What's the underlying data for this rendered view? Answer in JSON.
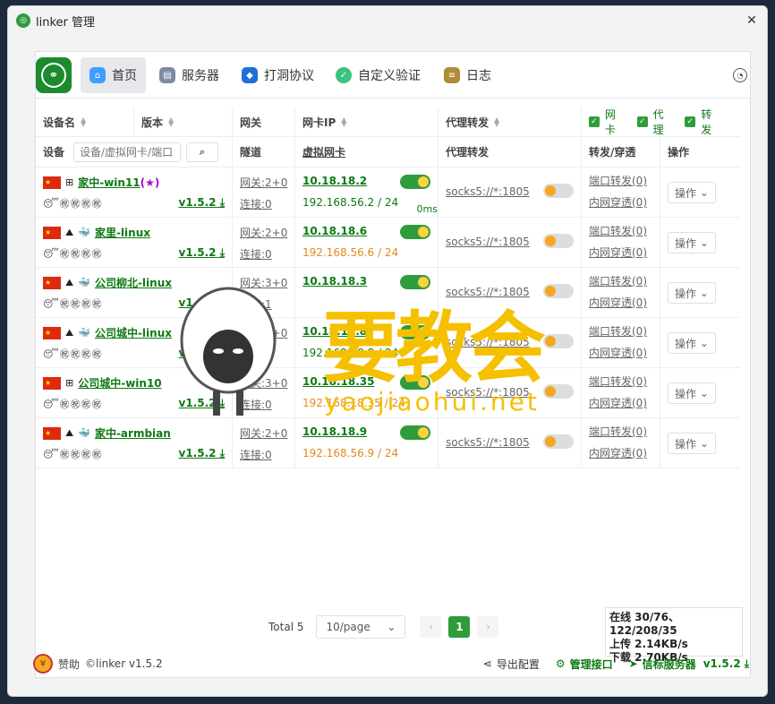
{
  "window": {
    "title": "linker 管理",
    "close_symbol": "✕"
  },
  "nav": {
    "items": [
      {
        "label": "首页",
        "icon": "home-icon",
        "active": true
      },
      {
        "label": "服务器",
        "icon": "server-icon"
      },
      {
        "label": "打洞协议",
        "icon": "protocol-icon"
      },
      {
        "label": "自定义验证",
        "icon": "shield-icon"
      },
      {
        "label": "日志",
        "icon": "log-icon"
      }
    ]
  },
  "header": {
    "device": "设备名",
    "version": "版本",
    "gateway": "网关",
    "nic_ip": "网卡IP",
    "proxy": "代理转发",
    "check_nic": "网卡",
    "check_proxy": "代理",
    "check_forward": "转发",
    "device2": "设备",
    "search_placeholder": "设备/虚拟网卡/端口",
    "tunnel": "隧道",
    "virtual_nic": "虚拟网卡",
    "proxy2": "代理转发",
    "forward_pen": "转发/穿透",
    "ops": "操作"
  },
  "rows": [
    {
      "name": "家中-win11",
      "star": "(★)",
      "os": "win",
      "emojis": "😴㊗㊗㊗㊗",
      "version": "v1.5.2",
      "gateway": "网关:2+0",
      "conn": "连接:0",
      "ip": "10.18.18.2",
      "lan": "192.168.56.2 / 24",
      "lan_orange": false,
      "ms": "0ms",
      "proxy": "socks5://*:1805",
      "port_fwd": "端口转发(0)",
      "lan_pen": "内网穿透(0)",
      "op": "操作"
    },
    {
      "name": "家里-linux",
      "star": "",
      "os": "linux",
      "emojis": "😴㊗㊗㊗㊗",
      "version": "v1.5.2",
      "gateway": "网关:2+0",
      "conn": "连接:0",
      "ip": "10.18.18.6",
      "lan": "192.168.56.6 / 24",
      "lan_orange": true,
      "ms": "",
      "proxy": "socks5://*:1805",
      "port_fwd": "端口转发(0)",
      "lan_pen": "内网穿透(0)",
      "op": "操作"
    },
    {
      "name": "公司柳北-linux",
      "star": "",
      "os": "linux",
      "emojis": "😴㊗㊗㊗㊗",
      "version": "v1.5.2",
      "gateway": "网关:3+0",
      "conn": "连接:1",
      "ip": "10.18.18.3",
      "lan": "",
      "lan_orange": false,
      "ms": "",
      "proxy": "socks5://*:1805",
      "port_fwd": "端口转发(0)",
      "lan_pen": "内网穿透(0)",
      "op": "操作"
    },
    {
      "name": "公司城中-linux",
      "star": "",
      "os": "linux",
      "emojis": "😴㊗㊗㊗㊗",
      "version": "v1.5.2",
      "gateway": "网关:3+0",
      "conn": "连接:0",
      "ip": "10.18.18.8",
      "lan": "192.168.18.8 / 24",
      "lan_orange": false,
      "ms": "",
      "proxy": "socks5://*:1805",
      "port_fwd": "端口转发(0)",
      "lan_pen": "内网穿透(0)",
      "op": "操作"
    },
    {
      "name": "公司城中-win10",
      "star": "",
      "os": "win",
      "emojis": "😴㊗㊗㊗㊗",
      "version": "v1.5.2",
      "gateway": "网关:3+0",
      "conn": "连接:0",
      "ip": "10.18.18.35",
      "lan": "192.168.18.35 / 24",
      "lan_orange": true,
      "ms": "",
      "proxy": "socks5://*:1805",
      "port_fwd": "端口转发(0)",
      "lan_pen": "内网穿透(0)",
      "op": "操作"
    },
    {
      "name": "家中-armbian",
      "star": "",
      "os": "linux",
      "emojis": "😴㊗㊗㊗㊗",
      "version": "v1.5.2",
      "gateway": "网关:2+0",
      "conn": "连接:0",
      "ip": "10.18.18.9",
      "lan": "192.168.56.9 / 24",
      "lan_orange": true,
      "ms": "",
      "proxy": "socks5://*:1805",
      "port_fwd": "端口转发(0)",
      "lan_pen": "内网穿透(0)",
      "op": "操作"
    }
  ],
  "pager": {
    "total": "Total 5",
    "size": "10/page",
    "current": "1",
    "prev": "‹",
    "next": "›"
  },
  "stats": {
    "online": "在线 30/76、122/208/35",
    "upload": "上传 2.14KB/s",
    "download": "下载 2.70KB/s"
  },
  "footer": {
    "donate": "赞助",
    "copyright": "©linker v1.5.2",
    "export": "导出配置",
    "manage": "管理接口",
    "signal": "信标服务器",
    "version": "v1.5.2"
  },
  "watermark": {
    "text": "要教会",
    "url": "yaojiaohui.net"
  }
}
